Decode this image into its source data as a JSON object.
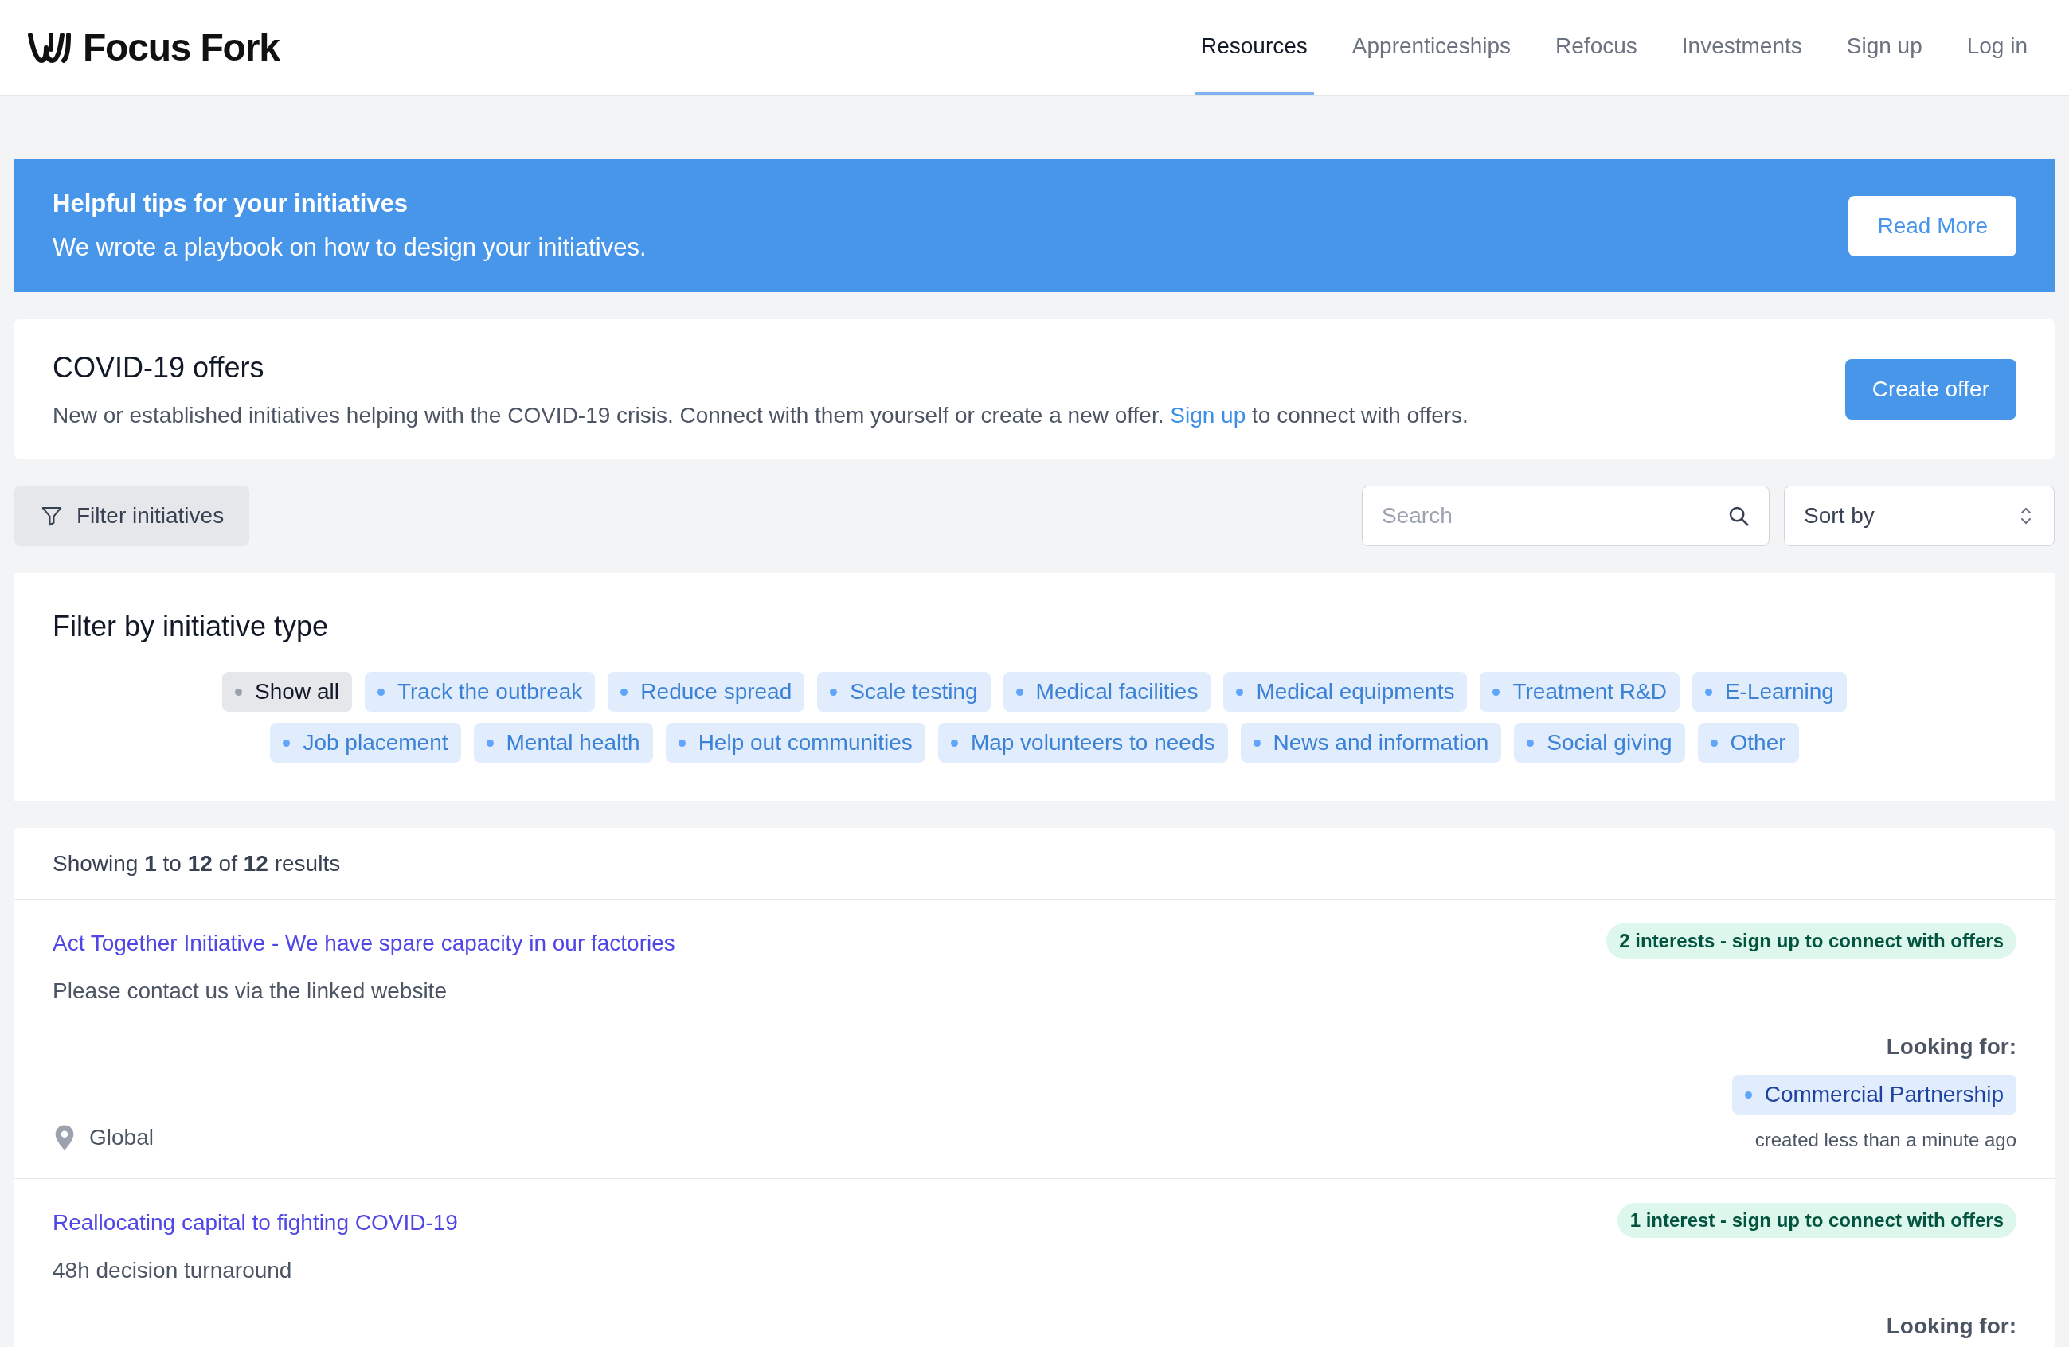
{
  "header": {
    "logo": "Focus Fork",
    "nav": [
      {
        "label": "Resources",
        "selected": true
      },
      {
        "label": "Apprenticeships",
        "selected": false
      },
      {
        "label": "Refocus",
        "selected": false
      },
      {
        "label": "Investments",
        "selected": false
      },
      {
        "label": "Sign up",
        "selected": false
      },
      {
        "label": "Log in",
        "selected": false
      }
    ]
  },
  "banner": {
    "title": "Helpful tips for your initiatives",
    "text": "We wrote a playbook on how to design your initiatives.",
    "button": "Read More"
  },
  "offers": {
    "title": "COVID-19 offers",
    "text_before": "New or established initiatives helping with the COVID-19 crisis. Connect with them yourself or create a new offer.",
    "link": "Sign up",
    "text_after": "to connect with offers.",
    "button": "Create offer"
  },
  "toolbar": {
    "filter_button": "Filter initiatives",
    "search": {
      "placeholder": "Search"
    },
    "sort": "Sort by"
  },
  "filter": {
    "title": "Filter by initiative type",
    "chip_rows": [
      [
        {
          "label": "Show all",
          "selected": true
        },
        {
          "label": "Track the outbreak",
          "selected": false
        },
        {
          "label": "Reduce spread",
          "selected": false
        },
        {
          "label": "Scale testing",
          "selected": false
        },
        {
          "label": "Medical facilities",
          "selected": false
        },
        {
          "label": "Medical equipments",
          "selected": false
        },
        {
          "label": "Treatment R&D",
          "selected": false
        },
        {
          "label": "E-Learning",
          "selected": false
        }
      ],
      [
        {
          "label": "Job placement",
          "selected": false
        },
        {
          "label": "Mental health",
          "selected": false
        },
        {
          "label": "Help out communities",
          "selected": false
        },
        {
          "label": "Map volunteers to needs",
          "selected": false
        },
        {
          "label": "News and information",
          "selected": false
        },
        {
          "label": "Social giving",
          "selected": false
        },
        {
          "label": "Other",
          "selected": false
        }
      ]
    ]
  },
  "results": {
    "summary": "Showing **1** to **12** of **12** results",
    "items": [
      {
        "title": "Act Together Initiative - We have spare capacity in our factories",
        "description": "Please contact us via the linked website",
        "badge": "2 interests - sign up to connect with offers",
        "looking_for": "Looking for:",
        "tags": [
          "Commercial Partnership"
        ],
        "location": "Global",
        "created": "created less than a minute ago"
      },
      {
        "title": "Reallocating capital to fighting COVID-19",
        "description": "48h decision turnaround",
        "badge": "1 interest - sign up to connect with offers",
        "looking_for": "Looking for:"
      }
    ]
  }
}
